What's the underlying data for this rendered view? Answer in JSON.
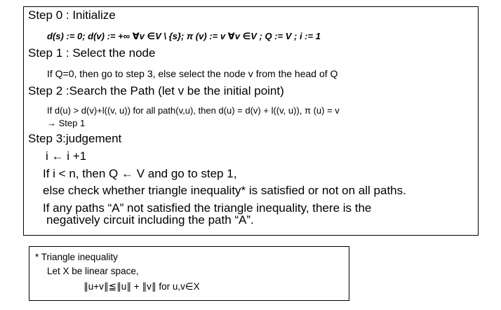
{
  "algorithm": {
    "step0_title": "Step 0 : Initialize",
    "step0_body": "d(s) := 0; d(v) := +∞  ∀v  ∈V  \\  {s};  π (v) := v  ∀v  ∈V ;  Q := V ;  i := 1",
    "step1_title": "Step 1 : Select the node",
    "step1_body": "If Q=0, then go to step 3, else select the node v from the head of Q",
    "step2_title": "Step 2 :Search the Path (let v be the initial point)",
    "step2_body1": "If d(u) > d(v)+l((v, u)) for all path(v,u), then d(u) = d(v) + l((v, u)),  π (u) = v",
    "step2_body2": "→   Step 1",
    "step3_title": "Step 3:judgement",
    "step3_line1": "i ← i +1",
    "step3_line2": "If i < n, then Q ← V and go to step 1,",
    "step3_line3": "else check whether triangle inequality* is satisfied or not on all paths.",
    "step3_line4": "If any paths “A” not satisfied the triangle inequality, there is the",
    "step3_line5": "negatively circuit including the path “A”."
  },
  "footnote": {
    "line1": "* Triangle inequality",
    "line2": "Let X be linear space,",
    "line3": "∥u+v∥≦∥u∥ + ∥v∥  for u,v∈X"
  }
}
